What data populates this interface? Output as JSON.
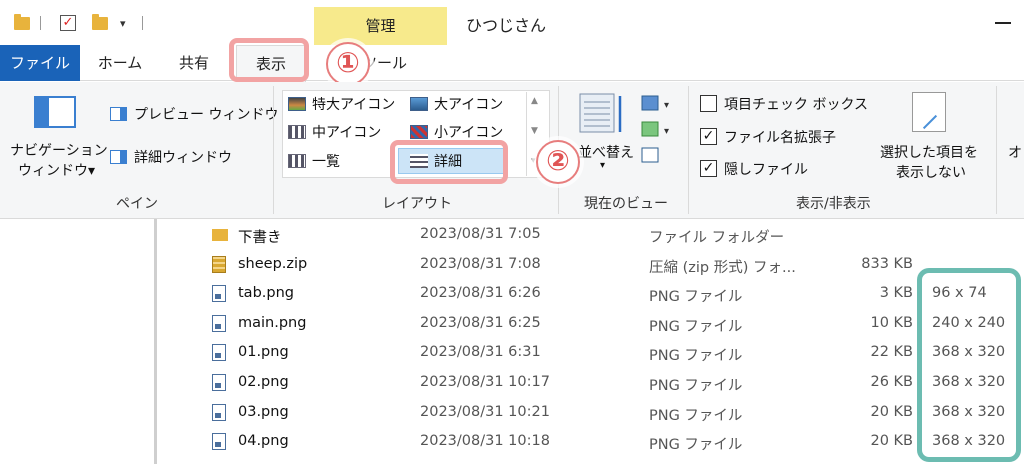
{
  "window": {
    "title": "ひつじさん",
    "context_tab_group": "管理"
  },
  "tabs": {
    "file": "ファイル",
    "home": "ホーム",
    "share": "共有",
    "view": "表示",
    "picture_tools": "ツール"
  },
  "annotations": {
    "step1": "①",
    "step2": "②"
  },
  "ribbon": {
    "pane": {
      "nav_pane_line1": "ナビゲーション",
      "nav_pane_line2": "ウィンドウ▾",
      "preview_pane": "プレビュー ウィンドウ",
      "details_pane": "詳細ウィンドウ",
      "label": "ペイン"
    },
    "layout": {
      "extra_large_icons": "特大アイコン",
      "large_icons": "大アイコン",
      "medium_icons": "中アイコン",
      "small_icons": "小アイコン",
      "list": "一覧",
      "details": "詳細",
      "label": "レイアウト"
    },
    "current_view": {
      "sort_by": "並べ替え",
      "label": "現在のビュー"
    },
    "show_hide": {
      "item_checkboxes": "項目チェック ボックス",
      "item_checkboxes_checked": false,
      "file_name_extensions": "ファイル名拡張子",
      "file_name_extensions_checked": true,
      "hidden_items": "隠しファイル",
      "hidden_items_checked": true,
      "hide_selected_line1": "選択した項目を",
      "hide_selected_line2": "表示しない",
      "label": "表示/非表示",
      "options_partial": "オ"
    }
  },
  "files": [
    {
      "name": "下書き",
      "date": "2023/08/31 7:05",
      "type": "ファイル フォルダー",
      "size": "",
      "dimensions": "",
      "icon": "folder-icon"
    },
    {
      "name": "sheep.zip",
      "date": "2023/08/31 7:08",
      "type": "圧縮 (zip 形式) フォ...",
      "size": "833 KB",
      "dimensions": "",
      "icon": "zip-icon"
    },
    {
      "name": "tab.png",
      "date": "2023/08/31 6:26",
      "type": "PNG ファイル",
      "size": "3 KB",
      "dimensions": "96 x 74",
      "icon": "png-icon"
    },
    {
      "name": "main.png",
      "date": "2023/08/31 6:25",
      "type": "PNG ファイル",
      "size": "10 KB",
      "dimensions": "240 x 240",
      "icon": "png-icon"
    },
    {
      "name": "01.png",
      "date": "2023/08/31 6:31",
      "type": "PNG ファイル",
      "size": "22 KB",
      "dimensions": "368 x 320",
      "icon": "png-icon"
    },
    {
      "name": "02.png",
      "date": "2023/08/31 10:17",
      "type": "PNG ファイル",
      "size": "26 KB",
      "dimensions": "368 x 320",
      "icon": "png-icon"
    },
    {
      "name": "03.png",
      "date": "2023/08/31 10:21",
      "type": "PNG ファイル",
      "size": "20 KB",
      "dimensions": "368 x 320",
      "icon": "png-icon"
    },
    {
      "name": "04.png",
      "date": "2023/08/31 10:18",
      "type": "PNG ファイル",
      "size": "20 KB",
      "dimensions": "368 x 320",
      "icon": "png-icon"
    }
  ],
  "colors": {
    "file_tab": "#1a63b8",
    "context_tab": "#f7ea8c",
    "step_highlight": "#f2a3a3",
    "dimension_highlight": "#6cbcb1"
  }
}
